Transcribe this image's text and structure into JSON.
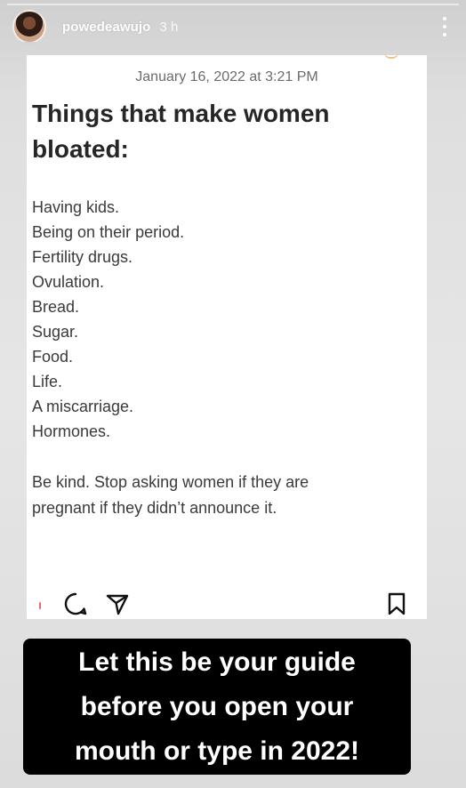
{
  "story": {
    "username": "powedeawujo",
    "time_ago": "3 h"
  },
  "post": {
    "date": "January 16, 2022 at 3:21 PM",
    "title_line1": "Things that make women",
    "title_line2": "bloated:",
    "items": [
      "Having kids.",
      "Being on their period.",
      "Fertility drugs.",
      "Ovulation.",
      "Bread.",
      "Sugar.",
      "Food.",
      "Life.",
      "A miscarriage.",
      "Hormones."
    ],
    "closing_line1": "Be kind. Stop asking women if they are",
    "closing_line2": "pregnant if they didn’t announce it."
  },
  "caption": {
    "line1": "Let this be your guide",
    "line2": "before you open your",
    "line3": "mouth or type in 2022!"
  },
  "icons": {
    "more": "more-vertical-icon",
    "comment": "comment-icon",
    "share": "share-icon",
    "save": "bookmark-icon"
  }
}
